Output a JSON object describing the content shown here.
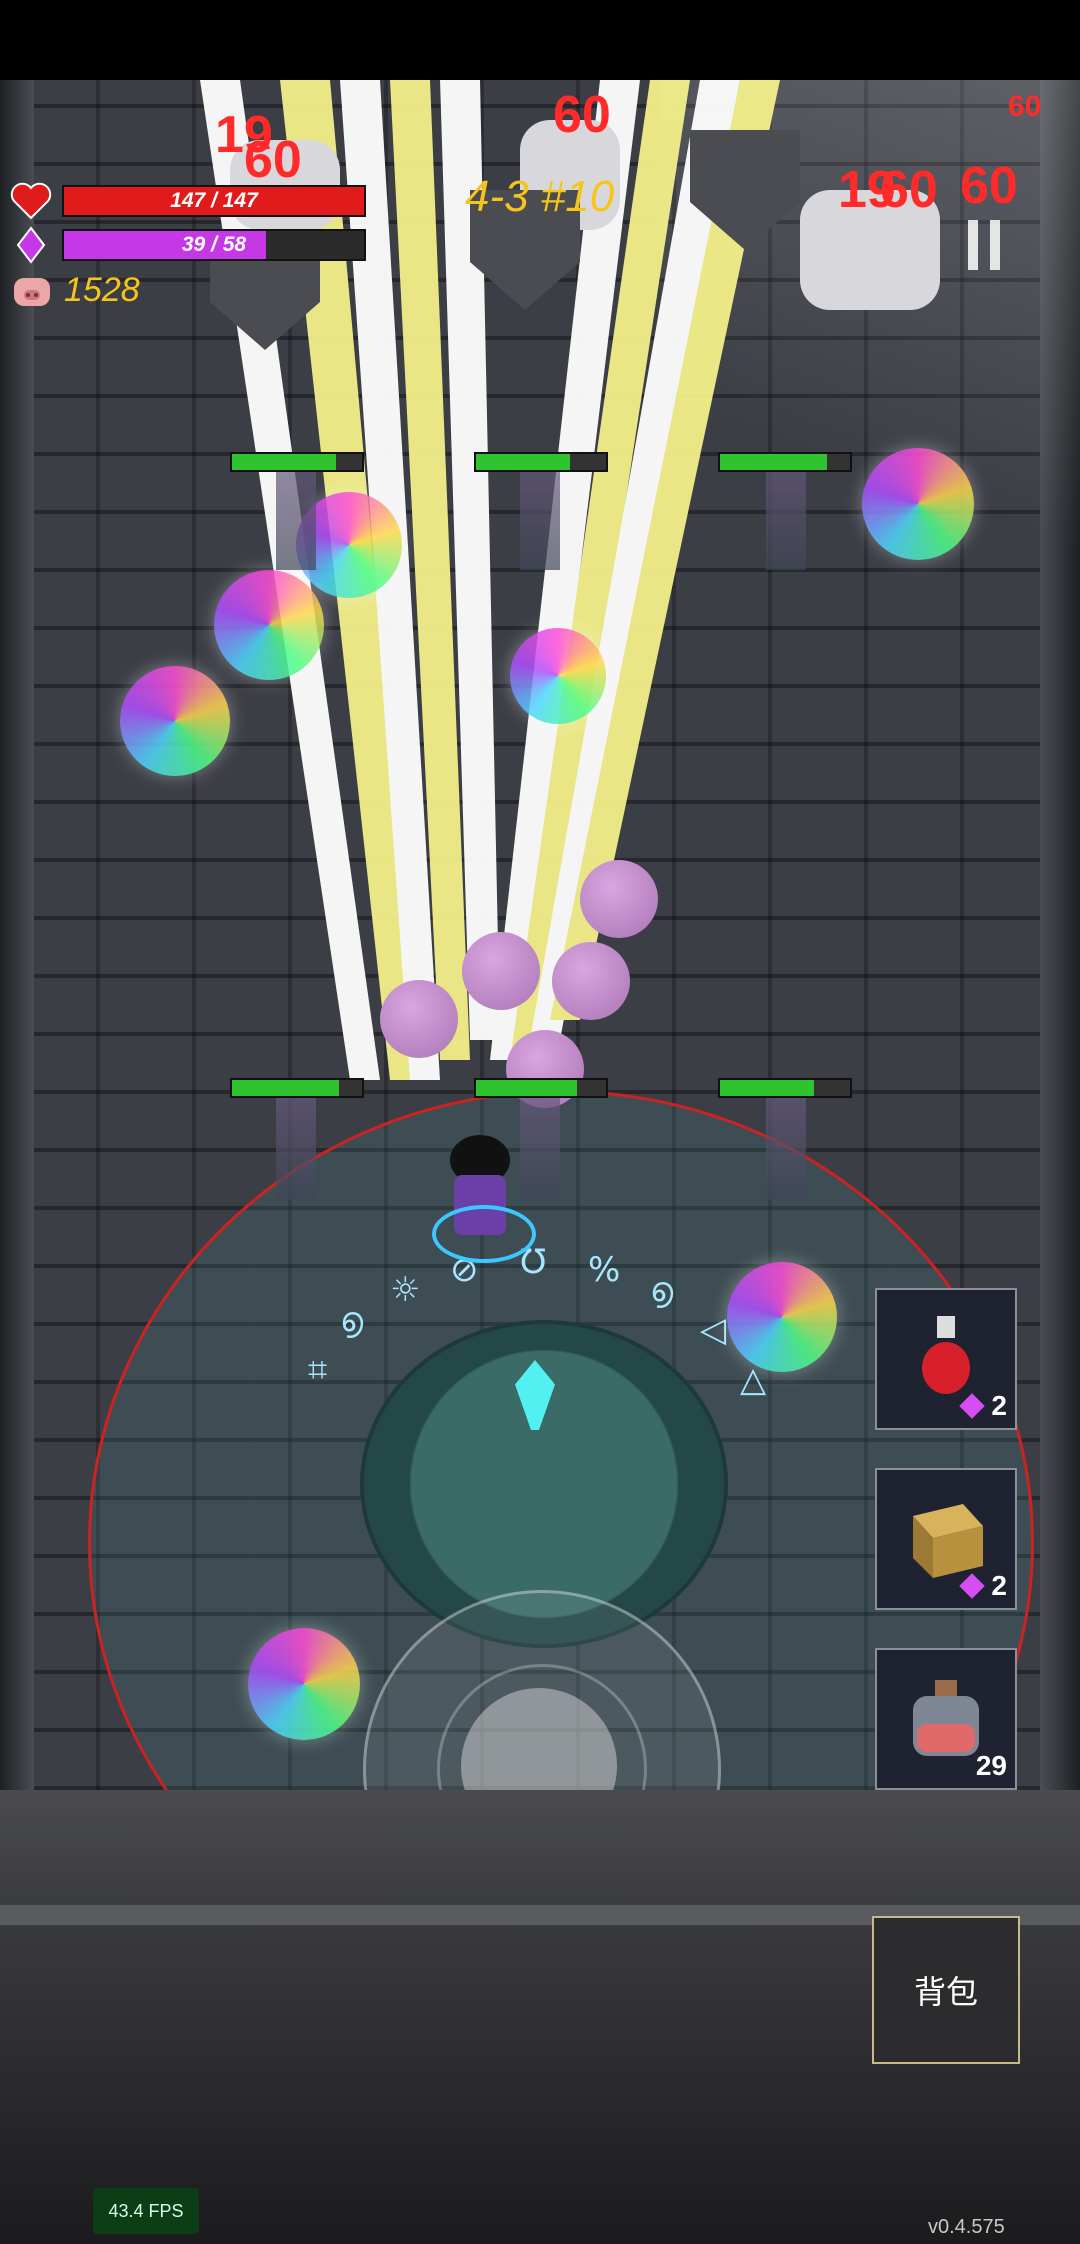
{
  "hud": {
    "health": {
      "current": 147,
      "max": 147,
      "text": "147 / 147",
      "color": "#e11b1b"
    },
    "mana": {
      "current": 39,
      "max": 58,
      "text": "39 / 58",
      "color": "#c637e6"
    },
    "coins": "1528",
    "wave": "4-3 #10"
  },
  "damage_numbers": [
    "19",
    "60",
    "60",
    "60",
    "60",
    "19",
    "60"
  ],
  "enemy_health_bars": [
    0.8,
    0.72,
    0.82,
    0.82,
    0.78,
    0.72
  ],
  "quick_items": [
    {
      "name": "red-potion",
      "cost": "2",
      "has_gem": true
    },
    {
      "name": "rune-cube",
      "cost": "2",
      "has_gem": true
    },
    {
      "name": "health-flask",
      "count": "29",
      "has_gem": false
    }
  ],
  "bag_button": "背包",
  "fps": "43.4 FPS",
  "version": "v0.4.575",
  "icons": {
    "heart": "heart-icon",
    "mana": "mana-gem-icon",
    "coins": "pig-icon",
    "pause": "pause-icon"
  }
}
